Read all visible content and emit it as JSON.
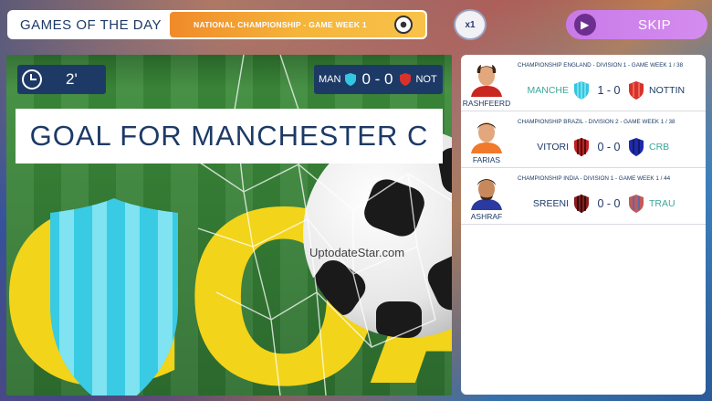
{
  "header": {
    "title": "GAMES OF THE DAY",
    "subtitle": "NATIONAL CHAMPIONSHIP - GAME WEEK 1",
    "speed_label": "x1",
    "skip_label": "SKIP"
  },
  "match": {
    "time": "2'",
    "home_abbr": "MAN",
    "away_abbr": "NOT",
    "score": "0 - 0",
    "banner": "GOAL FOR MANCHESTER C",
    "goal_word": "GOAL",
    "watermark": "UptodateStar.com",
    "home_color": "#34c6e0",
    "away_color": "#d8322a"
  },
  "results": [
    {
      "player": "RASHFEERD",
      "competition": "CHAMPIONSHIP ENGLAND - DIVISION 1 - GAME WEEK 1 / 38",
      "home": "MANCHE",
      "score": "1 - 0",
      "away": "NOTTIN",
      "home_color": "#34c6e0",
      "away_color": "#d8322a",
      "home_text_color": "#3aa89a",
      "away_text_color": "#1d3a66"
    },
    {
      "player": "FARIAS",
      "competition": "CHAMPIONSHIP BRAZIL - DIVISION 2 - GAME WEEK 1 / 38",
      "home": "VITORI",
      "score": "0 - 0",
      "away": "CRB",
      "home_color": "#c42020",
      "away_color": "#1e2aa8",
      "home_text_color": "#1d3a66",
      "away_text_color": "#3aa89a"
    },
    {
      "player": "ASHRAF",
      "competition": "CHAMPIONSHIP INDIA - DIVISION 1 - GAME WEEK 1 / 44",
      "home": "SREENI",
      "score": "0 - 0",
      "away": "TRAU",
      "home_color": "#8a1c1c",
      "away_color": "#c25a5a",
      "home_text_color": "#1d3a66",
      "away_text_color": "#3aa89a"
    }
  ]
}
